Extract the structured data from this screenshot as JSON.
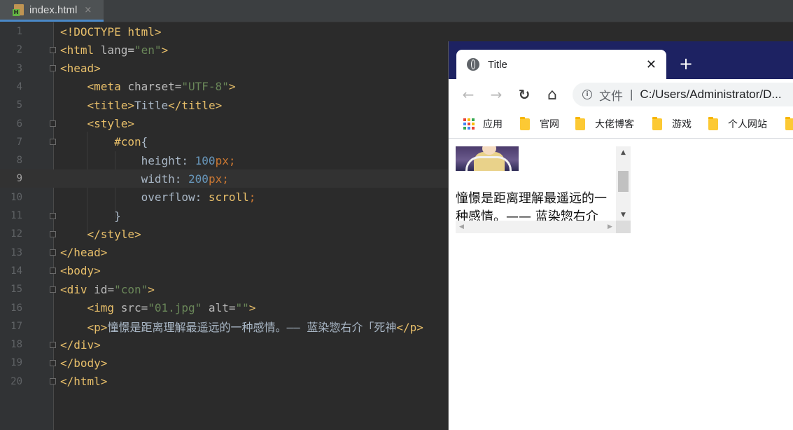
{
  "ide": {
    "tab_label": "index.html",
    "tab_close": "×",
    "file_badge": "H",
    "current_line": 9,
    "lines": [
      {
        "n": "1"
      },
      {
        "n": "2"
      },
      {
        "n": "3"
      },
      {
        "n": "4"
      },
      {
        "n": "5"
      },
      {
        "n": "6"
      },
      {
        "n": "7"
      },
      {
        "n": "8"
      },
      {
        "n": "9"
      },
      {
        "n": "10"
      },
      {
        "n": "11"
      },
      {
        "n": "12"
      },
      {
        "n": "13"
      },
      {
        "n": "14"
      },
      {
        "n": "15"
      },
      {
        "n": "16"
      },
      {
        "n": "17"
      },
      {
        "n": "18"
      },
      {
        "n": "19"
      },
      {
        "n": "20"
      }
    ],
    "code": [
      [
        [
          "tag",
          "<!DOCTYPE html>"
        ]
      ],
      [
        [
          "tag",
          "<html "
        ],
        [
          "attr",
          "lang="
        ],
        [
          "str",
          "\"en\""
        ],
        [
          "tag",
          ">"
        ]
      ],
      [
        [
          "tag",
          "<head>"
        ]
      ],
      [
        [
          "plain",
          "    "
        ],
        [
          "tag",
          "<meta "
        ],
        [
          "attr",
          "charset="
        ],
        [
          "str",
          "\"UTF-8\""
        ],
        [
          "tag",
          ">"
        ]
      ],
      [
        [
          "plain",
          "    "
        ],
        [
          "tag",
          "<title>"
        ],
        [
          "plain",
          "Title"
        ],
        [
          "tag",
          "</title>"
        ]
      ],
      [
        [
          "plain",
          "    "
        ],
        [
          "tag",
          "<style>"
        ]
      ],
      [
        [
          "plain",
          "        "
        ],
        [
          "tag",
          "#con"
        ],
        [
          "plain",
          "{"
        ]
      ],
      [
        [
          "plain",
          "            height: "
        ],
        [
          "num",
          "100"
        ],
        [
          "kw",
          "px"
        ],
        [
          "kw",
          ";"
        ]
      ],
      [
        [
          "plain",
          "            width: "
        ],
        [
          "num",
          "200"
        ],
        [
          "kw",
          "px"
        ],
        [
          "kw",
          ";"
        ]
      ],
      [
        [
          "plain",
          "            overflow: "
        ],
        [
          "tag",
          "scroll"
        ],
        [
          "kw",
          ";"
        ]
      ],
      [
        [
          "plain",
          "        }"
        ]
      ],
      [
        [
          "plain",
          "    "
        ],
        [
          "tag",
          "</style>"
        ]
      ],
      [
        [
          "tag",
          "</head>"
        ]
      ],
      [
        [
          "tag",
          "<body>"
        ]
      ],
      [
        [
          "tag",
          "<div "
        ],
        [
          "attr",
          "id="
        ],
        [
          "str",
          "\"con\""
        ],
        [
          "tag",
          ">"
        ]
      ],
      [
        [
          "plain",
          "    "
        ],
        [
          "tag",
          "<img "
        ],
        [
          "attr",
          "src="
        ],
        [
          "str",
          "\"01.jpg\""
        ],
        [
          "attr",
          " alt="
        ],
        [
          "str",
          "\"\""
        ],
        [
          "tag",
          ">"
        ]
      ],
      [
        [
          "plain",
          "    "
        ],
        [
          "tag",
          "<p>"
        ],
        [
          "plain",
          "憧憬是距离理解最遥远的一种感情。—— 蓝染惣右介「死神"
        ],
        [
          "tag",
          "</p>"
        ]
      ],
      [
        [
          "tag",
          "</div>"
        ]
      ],
      [
        [
          "tag",
          "</body>"
        ]
      ],
      [
        [
          "tag",
          "</html>"
        ]
      ]
    ]
  },
  "browser": {
    "tab_title": "Title",
    "tab_close": "✕",
    "new_tab": "+",
    "back": "←",
    "forward": "→",
    "reload": "↻",
    "home": "⌂",
    "info": "i",
    "scheme_label": "文件",
    "separator": "|",
    "url": "C:/Users/Administrator/D...",
    "bookmarks": [
      {
        "label": "应用",
        "icon": "apps-grid-icon"
      },
      {
        "label": "官网",
        "icon": "folder-icon"
      },
      {
        "label": "大佬博客",
        "icon": "folder-icon"
      },
      {
        "label": "游戏",
        "icon": "folder-icon"
      },
      {
        "label": "个人网站",
        "icon": "folder-icon"
      }
    ],
    "paragraph": "憧憬是距离理解最遥远的一种感情。—— 蓝染惣右介「死神",
    "scroll_up": "▲",
    "scroll_down": "▼",
    "scroll_left": "◀",
    "scroll_right": "▶"
  },
  "colors": {
    "editor_bg": "#2b2b2b",
    "tag": "#e8bf6a",
    "string": "#6a8759",
    "number": "#6897bb",
    "keyword": "#cc7832",
    "browser_tabstrip": "#1d2262",
    "folder": "#fcc934"
  }
}
